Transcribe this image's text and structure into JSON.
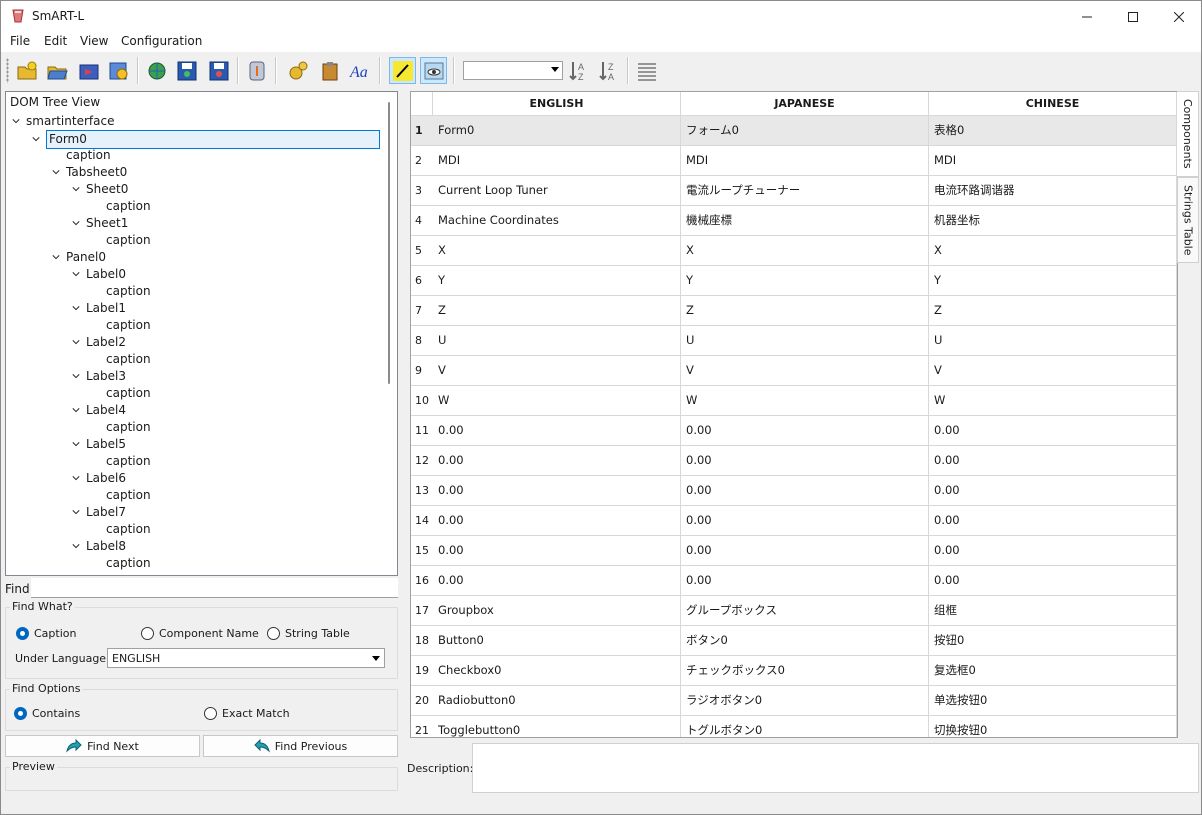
{
  "window": {
    "title": "SmART-L"
  },
  "menu": [
    "File",
    "Edit",
    "View",
    "Configuration"
  ],
  "toolbar": {
    "buttons": [
      "open-icon",
      "open-folder-icon",
      "export-icon",
      "settings-list-icon",
      "globe-open-icon",
      "save-icon",
      "save-globe-icon",
      "info-icon",
      "gears-icon",
      "clipboard-icon",
      "font-icon",
      "edit-pen-icon",
      "preview-eye-icon",
      "sort-az-icon",
      "sort-za-icon",
      "list-icon"
    ],
    "combo_value": ""
  },
  "tree": {
    "header": "DOM Tree View",
    "nodes": [
      {
        "label": "smartinterface",
        "depth": 0,
        "expand": true
      },
      {
        "label": "Form0",
        "depth": 1,
        "expand": true,
        "selected": true
      },
      {
        "label": "caption",
        "depth": 2,
        "expand": false
      },
      {
        "label": "Tabsheet0",
        "depth": 2,
        "expand": true
      },
      {
        "label": "Sheet0",
        "depth": 3,
        "expand": true
      },
      {
        "label": "caption",
        "depth": 4,
        "expand": false
      },
      {
        "label": "Sheet1",
        "depth": 3,
        "expand": true
      },
      {
        "label": "caption",
        "depth": 4,
        "expand": false
      },
      {
        "label": "Panel0",
        "depth": 2,
        "expand": true
      },
      {
        "label": "Label0",
        "depth": 3,
        "expand": true
      },
      {
        "label": "caption",
        "depth": 4,
        "expand": false
      },
      {
        "label": "Label1",
        "depth": 3,
        "expand": true
      },
      {
        "label": "caption",
        "depth": 4,
        "expand": false
      },
      {
        "label": "Label2",
        "depth": 3,
        "expand": true
      },
      {
        "label": "caption",
        "depth": 4,
        "expand": false
      },
      {
        "label": "Label3",
        "depth": 3,
        "expand": true
      },
      {
        "label": "caption",
        "depth": 4,
        "expand": false
      },
      {
        "label": "Label4",
        "depth": 3,
        "expand": true
      },
      {
        "label": "caption",
        "depth": 4,
        "expand": false
      },
      {
        "label": "Label5",
        "depth": 3,
        "expand": true
      },
      {
        "label": "caption",
        "depth": 4,
        "expand": false
      },
      {
        "label": "Label6",
        "depth": 3,
        "expand": true
      },
      {
        "label": "caption",
        "depth": 4,
        "expand": false
      },
      {
        "label": "Label7",
        "depth": 3,
        "expand": true
      },
      {
        "label": "caption",
        "depth": 4,
        "expand": false
      },
      {
        "label": "Label8",
        "depth": 3,
        "expand": true
      },
      {
        "label": "caption",
        "depth": 4,
        "expand": false
      }
    ]
  },
  "find": {
    "label": "Find:",
    "value": "",
    "what_title": "Find What?",
    "radio_caption": "Caption",
    "radio_component": "Component Name",
    "radio_string_table": "String Table",
    "under_language_label": "Under Language:",
    "language": "ENGLISH",
    "options_title": "Find Options",
    "radio_contains": "Contains",
    "radio_exact": "Exact Match",
    "next_label": "Find Next",
    "previous_label": "Find Previous",
    "preview_title": "Preview"
  },
  "grid": {
    "columns": [
      "ENGLISH",
      "JAPANESE",
      "CHINESE"
    ],
    "rows": [
      [
        "1",
        "Form0",
        "フォーム0",
        "表格0"
      ],
      [
        "2",
        "MDI",
        "MDI",
        "MDI"
      ],
      [
        "3",
        "Current Loop Tuner",
        "電流ループチューナー",
        "电流环路调谐器"
      ],
      [
        "4",
        "Machine Coordinates",
        "機械座標",
        "机器坐标"
      ],
      [
        "5",
        "X",
        "X",
        "X"
      ],
      [
        "6",
        "Y",
        "Y",
        "Y"
      ],
      [
        "7",
        "Z",
        "Z",
        "Z"
      ],
      [
        "8",
        "U",
        "U",
        "U"
      ],
      [
        "9",
        "V",
        "V",
        "V"
      ],
      [
        "10",
        "W",
        "W",
        "W"
      ],
      [
        "11",
        "0.00",
        "0.00",
        "0.00"
      ],
      [
        "12",
        "0.00",
        "0.00",
        "0.00"
      ],
      [
        "13",
        "0.00",
        "0.00",
        "0.00"
      ],
      [
        "14",
        "0.00",
        "0.00",
        "0.00"
      ],
      [
        "15",
        "0.00",
        "0.00",
        "0.00"
      ],
      [
        "16",
        "0.00",
        "0.00",
        "0.00"
      ],
      [
        "17",
        "Groupbox",
        "グループボックス",
        "组框"
      ],
      [
        "18",
        "Button0",
        "ボタン0",
        "按钮0"
      ],
      [
        "19",
        "Checkbox0",
        "チェックボックス0",
        "复选框0"
      ],
      [
        "20",
        "Radiobutton0",
        "ラジオボタン0",
        "单选按钮0"
      ],
      [
        "21",
        "Togglebutton0",
        "トグルボタン0",
        "切换按钮0"
      ]
    ]
  },
  "side_tabs": [
    "Components",
    "Strings Table"
  ],
  "description": {
    "label": "Description:",
    "value": ""
  }
}
